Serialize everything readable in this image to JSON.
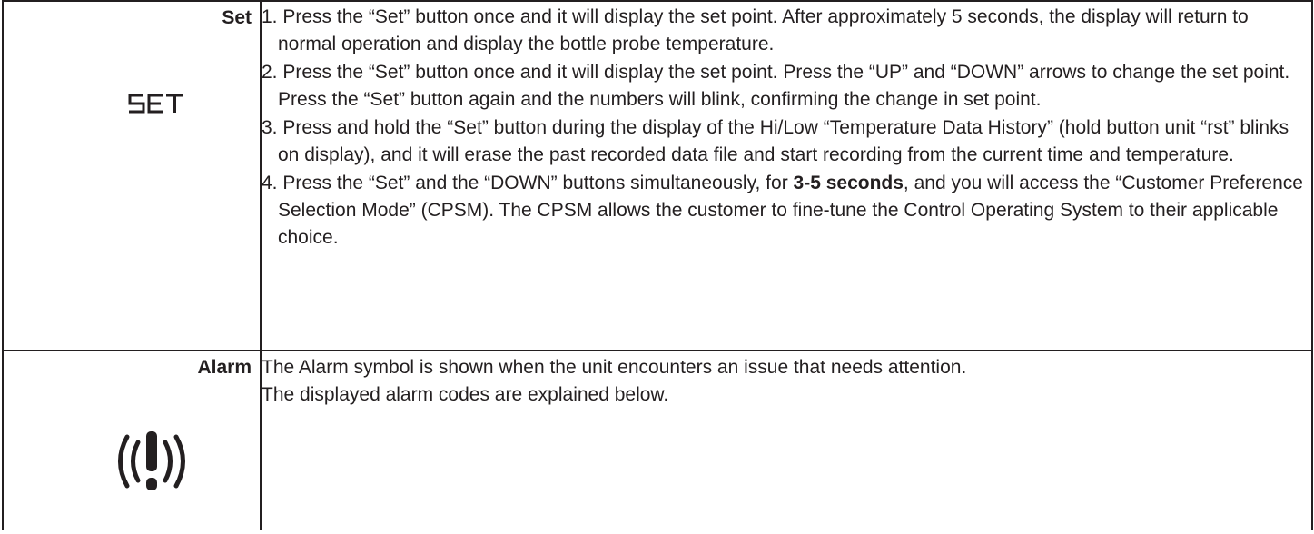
{
  "rows": [
    {
      "label": "Set",
      "icon": "set-button-icon",
      "steps": [
        {
          "number": "1.",
          "text": "Press the “Set” button once and it will display the set point. After approximately 5 seconds, the display will return to normal operation and display the bottle probe temperature."
        },
        {
          "number": "2.",
          "text": "Press the “Set” button once and it will display the set point. Press the “UP” and “DOWN” arrows to change the set point. Press the “Set” button again and the numbers will blink, confirming the change in set point."
        },
        {
          "number": "3.",
          "text": "Press and hold the “Set” button during the display of the Hi/Low “Temperature Data History” (hold button unit “rst” blinks on display), and it will erase the past recorded data file and start recording from the current time and temperature."
        },
        {
          "number": "4.",
          "text_before": "Press the “Set” and the “DOWN” buttons simultaneously, for ",
          "bold": "3-5 seconds",
          "text_after": ", and you will access the “Customer Preference Selection Mode” (CPSM). The CPSM allows the customer to fine-tune the Control Operating System to their applicable choice."
        }
      ]
    },
    {
      "label": "Alarm",
      "icon": "alarm-icon",
      "paragraphs": [
        "The Alarm symbol is shown when the unit encounters an issue that needs attention.",
        "The displayed alarm codes are explained below."
      ]
    }
  ],
  "colors": {
    "text": "#231f20",
    "border": "#231f20",
    "background": "#ffffff"
  }
}
